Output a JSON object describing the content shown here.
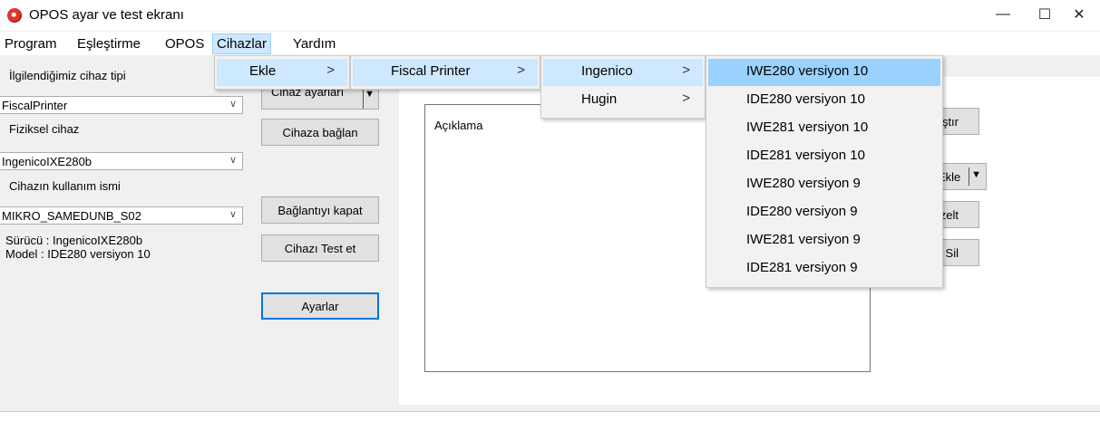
{
  "window": {
    "title": "OPOS ayar ve test ekranı",
    "minimize": "—",
    "maximize": "☐",
    "close": "✕"
  },
  "menubar": [
    "Program",
    "Eşleştirme",
    "OPOS",
    "Cihazlar",
    "Yardım"
  ],
  "left": {
    "device_type_label": "İlgilendiğimiz cihaz tipi",
    "device_type_value": "FiscalPrinter",
    "physical_label": "Fiziksel cihaz",
    "physical_value": "IngenicoIXE280b",
    "usage_label": "Cihazın kullanım ismi",
    "usage_value": "MIKRO_SAMEDUNB_S02",
    "driver": "Sürücü : IngenicoIXE280b",
    "model": "Model  : IDE280 versiyon 10"
  },
  "buttons": {
    "device_settings": "Cihaz ayarları",
    "connect": "Cihaza bağlan",
    "close_conn": "Bağlantıyı kapat",
    "test": "Cihazı Test et",
    "settings": "Ayarlar",
    "run": "Çalıştır",
    "add": "Ekle",
    "edit": "Düzelt",
    "delete": "Sil"
  },
  "group": {
    "description_label": "Açıklama"
  },
  "menus": {
    "cihazlar": [
      {
        "label": "Ekle",
        "submenu": true
      }
    ],
    "ekle": [
      {
        "label": "Fiscal Printer",
        "submenu": true
      }
    ],
    "fiscal": [
      {
        "label": "Ingenico",
        "submenu": true
      },
      {
        "label": "Hugin",
        "submenu": true
      }
    ],
    "ingenico": [
      "IWE280 versiyon 10",
      "IDE280 versiyon 10",
      "IWE281 versiyon 10",
      "IDE281 versiyon 10",
      "IWE280 versiyon 9",
      "IDE280 versiyon 9",
      "IWE281 versiyon 9",
      "IDE281 versiyon 9"
    ],
    "chevron": ">"
  },
  "colors": {
    "highlight": "#99d1ff",
    "hover": "#cde8ff",
    "app_icon": "#e0342a"
  }
}
